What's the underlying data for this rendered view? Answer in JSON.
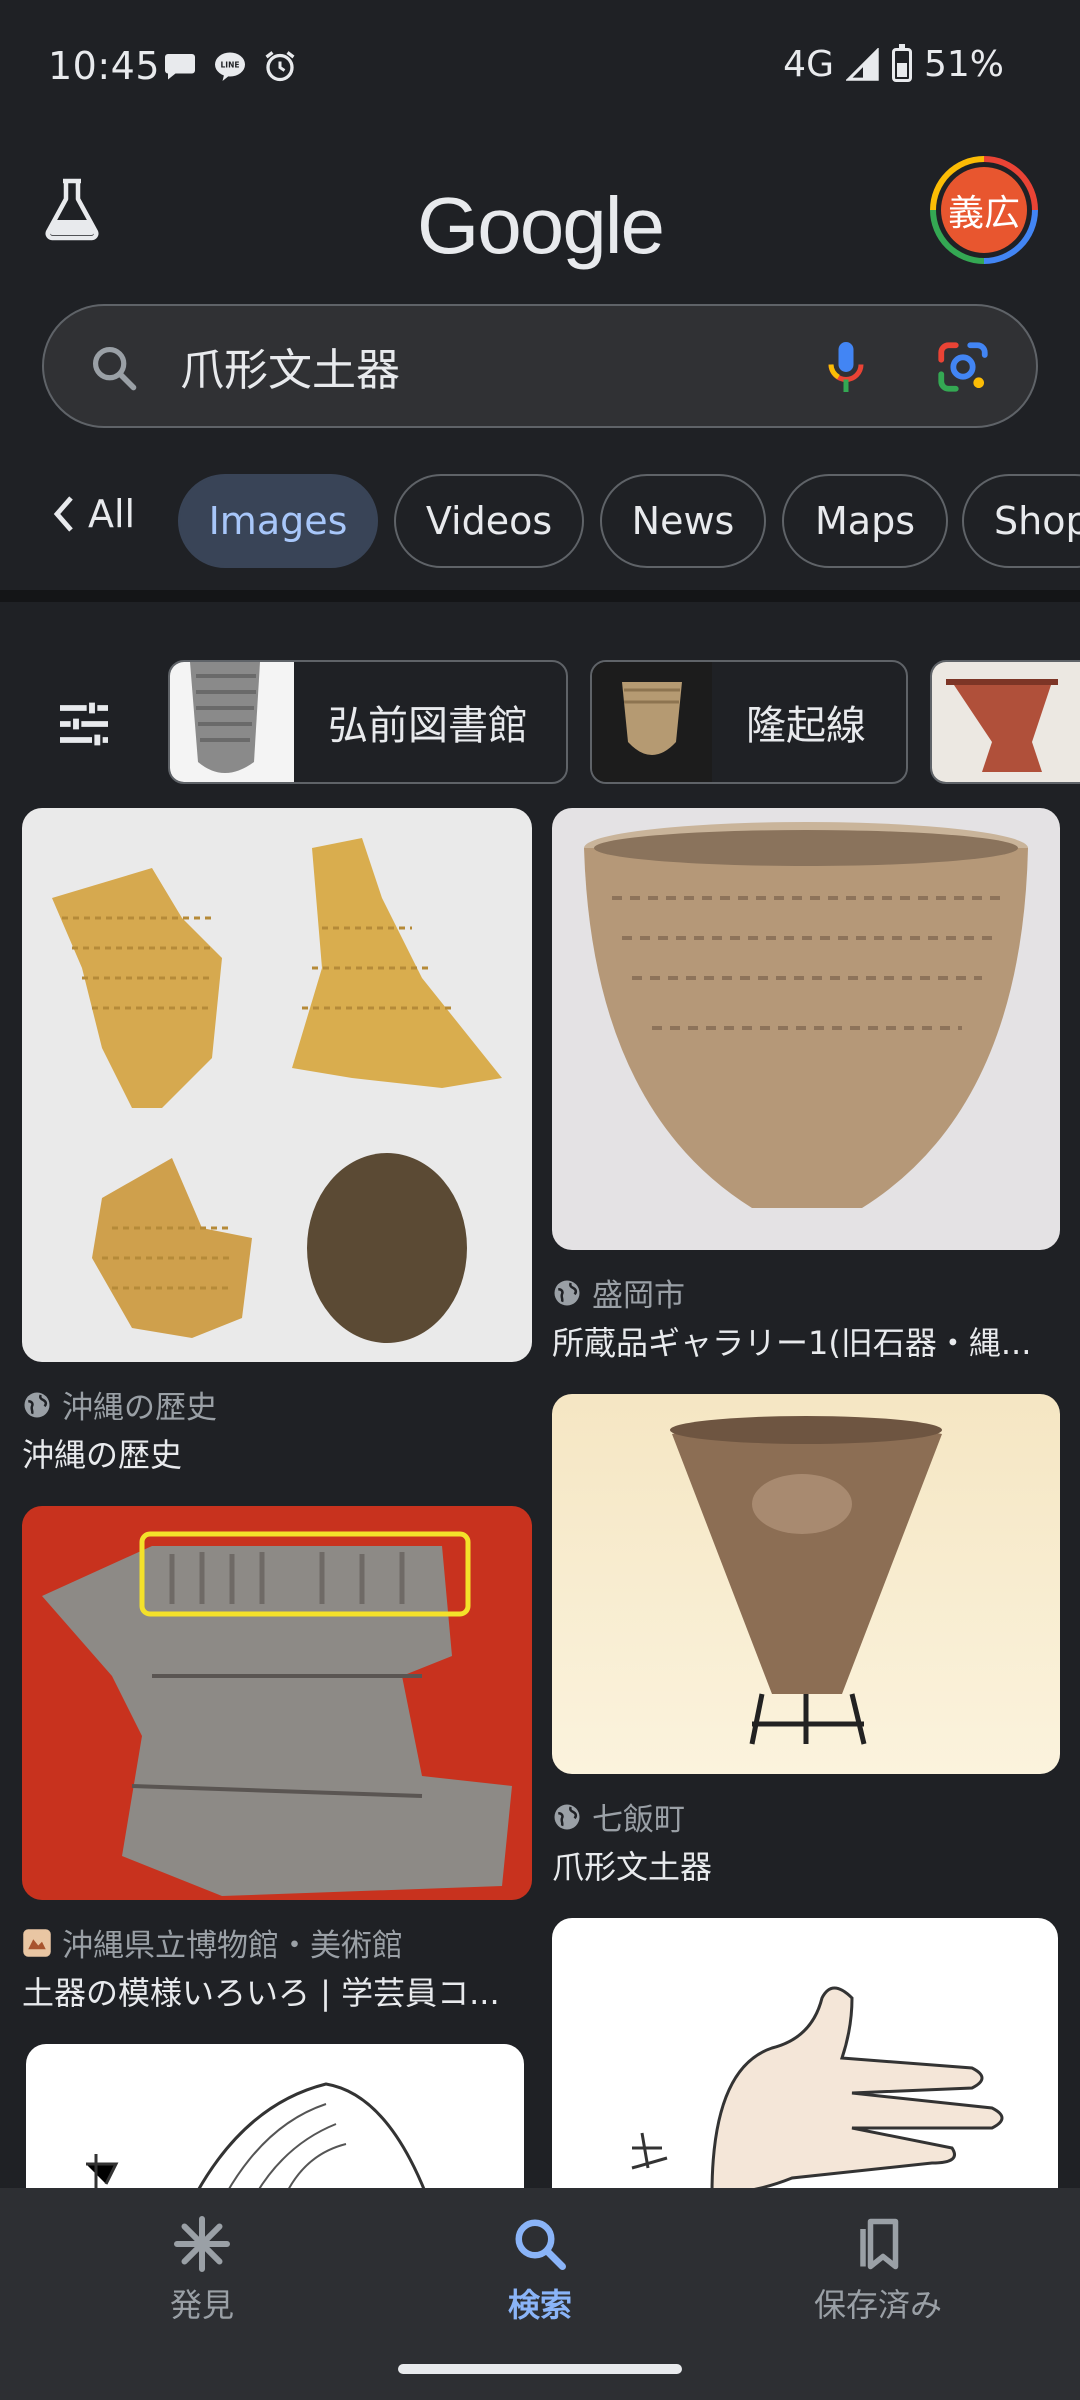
{
  "status_bar": {
    "time": "10:45",
    "network": "4G",
    "battery_percent": "51%",
    "notification_icons": [
      "chat-bubble-icon",
      "line-app-icon",
      "alarm-icon"
    ]
  },
  "header": {
    "logo_text": "Google",
    "avatar_text": "義広"
  },
  "search": {
    "query": "爪形文土器"
  },
  "tabs": {
    "back_label": "All",
    "items": [
      "Images",
      "Videos",
      "News",
      "Maps",
      "Shop"
    ],
    "active": "Images"
  },
  "filter_chips": [
    {
      "label": "弘前図書館"
    },
    {
      "label": "隆起線"
    },
    {
      "label": ""
    }
  ],
  "results": {
    "left": [
      {
        "source": "沖縄の歴史",
        "title": "沖縄の歴史"
      },
      {
        "source": "沖縄県立博物館・美術館",
        "title": "土器の模様いろいろ | 学芸員コ..."
      }
    ],
    "right": [
      {
        "source": "盛岡市",
        "title": "所蔵品ギャラリー1(旧石器・縄..."
      },
      {
        "source": "七飯町",
        "title": "爪形文土器"
      }
    ]
  },
  "bottom_nav": {
    "items": [
      {
        "label": "発見",
        "icon": "asterisk-icon"
      },
      {
        "label": "検索",
        "icon": "search-icon"
      },
      {
        "label": "保存済み",
        "icon": "bookmark-icon"
      }
    ],
    "active": "検索"
  },
  "colors": {
    "background": "#1f2125",
    "active_tab_bg": "#394457",
    "active_tab_text": "#a8c7fa",
    "accent": "#8ab4f8"
  }
}
